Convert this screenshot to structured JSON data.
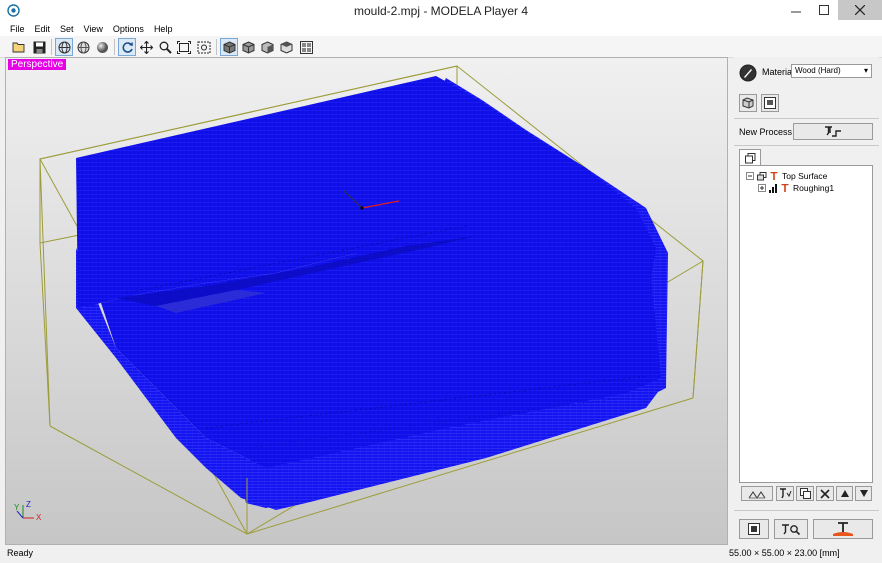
{
  "window": {
    "title": "mould-2.mpj - MODELA Player 4"
  },
  "menu": [
    "File",
    "Edit",
    "Set",
    "View",
    "Options",
    "Help"
  ],
  "toolbar": {
    "icons": [
      "open-icon",
      "save-icon",
      "wireframe-sphere-icon",
      "shaded-sphere-icon",
      "solid-sphere-icon",
      "rotate-icon",
      "pan-icon",
      "zoom-icon",
      "fit-icon",
      "zoom-window-icon",
      "iso-view-icon",
      "front-view-icon",
      "side-view-icon",
      "top-view-icon",
      "multi-view-icon"
    ]
  },
  "viewport": {
    "view_label": "Perspective",
    "axes": {
      "x": "X",
      "y": "Y",
      "z": "Z"
    },
    "colors": {
      "model": "#1010ee",
      "bbox": "#9c9c3a",
      "view_label_bg": "#e600e6"
    }
  },
  "panel": {
    "material_label": "Material",
    "material_value": "Wood (Hard)",
    "new_process_label": "New Process",
    "tree": {
      "root_label": "Top Surface",
      "child_label": "Roughing1"
    }
  },
  "status": {
    "left": "Ready",
    "right": "55.00 × 55.00 × 23.00 [mm]"
  }
}
